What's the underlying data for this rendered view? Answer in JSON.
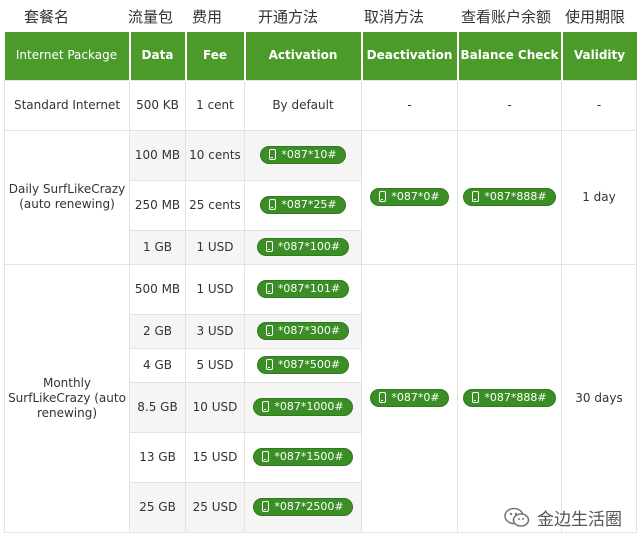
{
  "cn_header": [
    "套餐名",
    "流量包",
    "费用",
    "开通方法",
    "取消方法",
    "查看账户余额",
    "使用期限"
  ],
  "columns": [
    "Internet Package",
    "Data",
    "Fee",
    "Activation",
    "Deactivation",
    "Balance Check",
    "Validity"
  ],
  "rows": {
    "standard": {
      "name": "Standard Internet",
      "data": "500 KB",
      "fee": "1 cent",
      "activation": "By default",
      "deactivation": "-",
      "balance": "-",
      "validity": "-"
    },
    "daily": {
      "name": "Daily SurfLikeCrazy (auto renewing)",
      "deactivation": "*087*0#",
      "balance": "*087*888#",
      "validity": "1 day",
      "tiers": [
        {
          "data": "100 MB",
          "fee": "10 cents",
          "code": "*087*10#"
        },
        {
          "data": "250 MB",
          "fee": "25 cents",
          "code": "*087*25#"
        },
        {
          "data": "1 GB",
          "fee": "1 USD",
          "code": "*087*100#"
        }
      ]
    },
    "monthly": {
      "name": "Monthly SurfLikeCrazy (auto renewing)",
      "deactivation": "*087*0#",
      "balance": "*087*888#",
      "validity": "30 days",
      "tiers": [
        {
          "data": "500 MB",
          "fee": "1 USD",
          "code": "*087*101#"
        },
        {
          "data": "2 GB",
          "fee": "3 USD",
          "code": "*087*300#"
        },
        {
          "data": "4 GB",
          "fee": "5 USD",
          "code": "*087*500#"
        },
        {
          "data": "8.5 GB",
          "fee": "10 USD",
          "code": "*087*1000#"
        },
        {
          "data": "13 GB",
          "fee": "15 USD",
          "code": "*087*1500#"
        },
        {
          "data": "25 GB",
          "fee": "25 USD",
          "code": "*087*2500#"
        }
      ]
    }
  },
  "watermark": {
    "text": "金边生活圈",
    "icon": "wechat-icon"
  },
  "colors": {
    "header_bg": "#4b9a2a",
    "pill_bg": "#3a8e25"
  }
}
